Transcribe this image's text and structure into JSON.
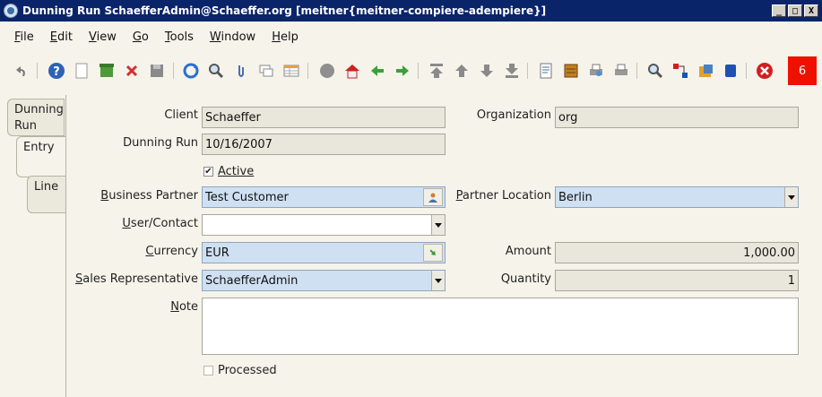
{
  "window": {
    "title": "Dunning Run  SchaefferAdmin@Schaeffer.org [meitner{meitner-compiere-adempiere}]",
    "minimize": "_",
    "maximize": "□",
    "close": "X"
  },
  "menu": [
    {
      "label": "File",
      "u": "F",
      "rest": "ile"
    },
    {
      "label": "Edit",
      "u": "E",
      "rest": "dit"
    },
    {
      "label": "View",
      "u": "V",
      "rest": "iew"
    },
    {
      "label": "Go",
      "u": "G",
      "rest": "o"
    },
    {
      "label": "Tools",
      "u": "T",
      "rest": "ools"
    },
    {
      "label": "Window",
      "u": "W",
      "rest": "indow"
    },
    {
      "label": "Help",
      "u": "H",
      "rest": "elp"
    }
  ],
  "toolbar": {
    "icons": [
      "undo-icon",
      "help-icon",
      "new-record-icon",
      "copy-record-icon",
      "delete-icon",
      "save-icon",
      "refresh-icon",
      "find-icon",
      "attachment-icon",
      "chat-icon",
      "grid-toggle-icon",
      "history-icon",
      "home-icon",
      "previous-record-icon",
      "next-record-icon",
      "first-record-icon",
      "parent-record-icon",
      "detail-record-icon",
      "last-record-icon",
      "report-icon",
      "archive-icon",
      "print-preview-icon",
      "print-icon",
      "zoom-across-icon",
      "workflow-icon",
      "request-icon",
      "product-info-icon",
      "end-icon"
    ],
    "notification_count": "6"
  },
  "tabs": [
    {
      "label_1": "Dunning",
      "label_2": "Run"
    },
    {
      "label": "Entry"
    },
    {
      "label": "Line"
    }
  ],
  "form": {
    "client": {
      "label": "Client",
      "value": "Schaeffer"
    },
    "organization": {
      "label": "Organization",
      "value": "org"
    },
    "dunning_run": {
      "label": "Dunning Run",
      "value": "10/16/2007"
    },
    "active": {
      "label": "Active",
      "checked": true
    },
    "business_partner": {
      "label": "Business Partner",
      "value": "Test Customer"
    },
    "partner_location": {
      "label": "Partner Location",
      "value": "Berlin"
    },
    "user_contact": {
      "label": "User/Contact",
      "value": ""
    },
    "currency": {
      "label": "Currency",
      "value": "EUR"
    },
    "amount": {
      "label": "Amount",
      "value": "1,000.00"
    },
    "sales_rep": {
      "label": "Sales Representative",
      "value": "SchaefferAdmin"
    },
    "quantity": {
      "label": "Quantity",
      "value": "1"
    },
    "note": {
      "label": "Note",
      "value": ""
    },
    "processed": {
      "label": "Processed",
      "checked": false
    }
  },
  "colors": {
    "mandatory_field": "#cfe0f3",
    "readonly_field": "#e9e7dc",
    "title_bar": "#0a246a",
    "notification": "#ee1100"
  }
}
